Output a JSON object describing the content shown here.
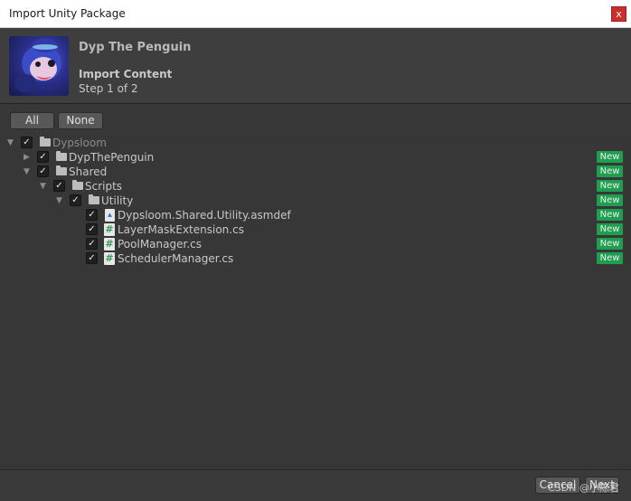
{
  "window": {
    "title": "Import Unity Package",
    "close_label": "x"
  },
  "package": {
    "name": "Dyp The Penguin",
    "section_title": "Import Content",
    "step_text": "Step 1 of 2"
  },
  "toolbar": {
    "all_label": "All",
    "none_label": "None"
  },
  "tree": {
    "new_badge": "New",
    "items": [
      {
        "label": "Dypsloom",
        "checked": "✓",
        "badge": ""
      },
      {
        "label": "DypThePenguin",
        "checked": "✓",
        "badge": "New"
      },
      {
        "label": "Shared",
        "checked": "✓",
        "badge": "New"
      },
      {
        "label": "Scripts",
        "checked": "✓",
        "badge": "New"
      },
      {
        "label": "Utility",
        "checked": "✓",
        "badge": "New"
      },
      {
        "label": "Dypsloom.Shared.Utility.asmdef",
        "checked": "✓",
        "badge": "New"
      },
      {
        "label": "LayerMaskExtension.cs",
        "checked": "✓",
        "badge": "New"
      },
      {
        "label": "PoolManager.cs",
        "checked": "✓",
        "badge": "New"
      },
      {
        "label": "SchedulerManager.cs",
        "checked": "✓",
        "badge": "New"
      }
    ]
  },
  "footer": {
    "cancel_label": "Cancel",
    "next_label": "Next"
  },
  "watermark": "CSDN @小陈君",
  "colors": {
    "new_badge": "#1e9e4e",
    "panel_bg": "#383838",
    "close_button": "#c9302c"
  }
}
